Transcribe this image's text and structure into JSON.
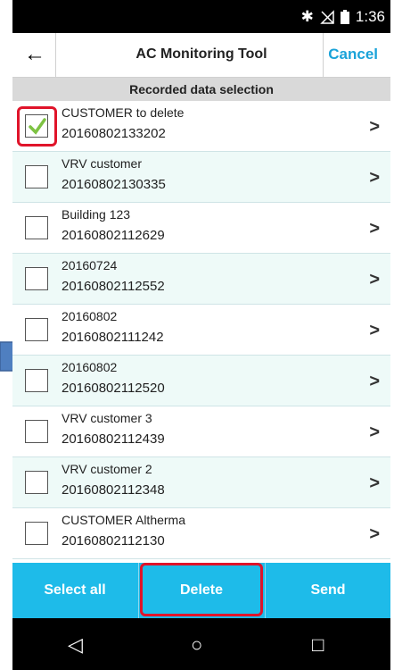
{
  "status": {
    "time": "1:36",
    "bluetooth_icon": "bluetooth-icon",
    "signal_icon": "no-signal-icon",
    "battery_icon": "battery-icon"
  },
  "header": {
    "back_icon": "back-arrow-icon",
    "title": "AC Monitoring Tool",
    "cancel": "Cancel"
  },
  "section_title": "Recorded data selection",
  "rows": [
    {
      "name": "CUSTOMER to delete",
      "date": "20160802133202",
      "checked": true
    },
    {
      "name": "VRV customer",
      "date": "20160802130335",
      "checked": false
    },
    {
      "name": "Building 123",
      "date": "20160802112629",
      "checked": false
    },
    {
      "name": "20160724",
      "date": "20160802112552",
      "checked": false
    },
    {
      "name": "20160802",
      "date": "20160802111242",
      "checked": false
    },
    {
      "name": "20160802",
      "date": "20160802112520",
      "checked": false
    },
    {
      "name": "VRV customer 3",
      "date": "20160802112439",
      "checked": false
    },
    {
      "name": "VRV customer 2",
      "date": "20160802112348",
      "checked": false
    },
    {
      "name": "CUSTOMER Altherma",
      "date": "20160802112130",
      "checked": false
    }
  ],
  "chevron": ">",
  "bottom": {
    "select_all": "Select all",
    "delete": "Delete",
    "send": "Send"
  },
  "colors": {
    "accent": "#1ebbe9",
    "cancel": "#1aa3d9",
    "highlight": "#e0142a",
    "check": "#7dc242"
  }
}
